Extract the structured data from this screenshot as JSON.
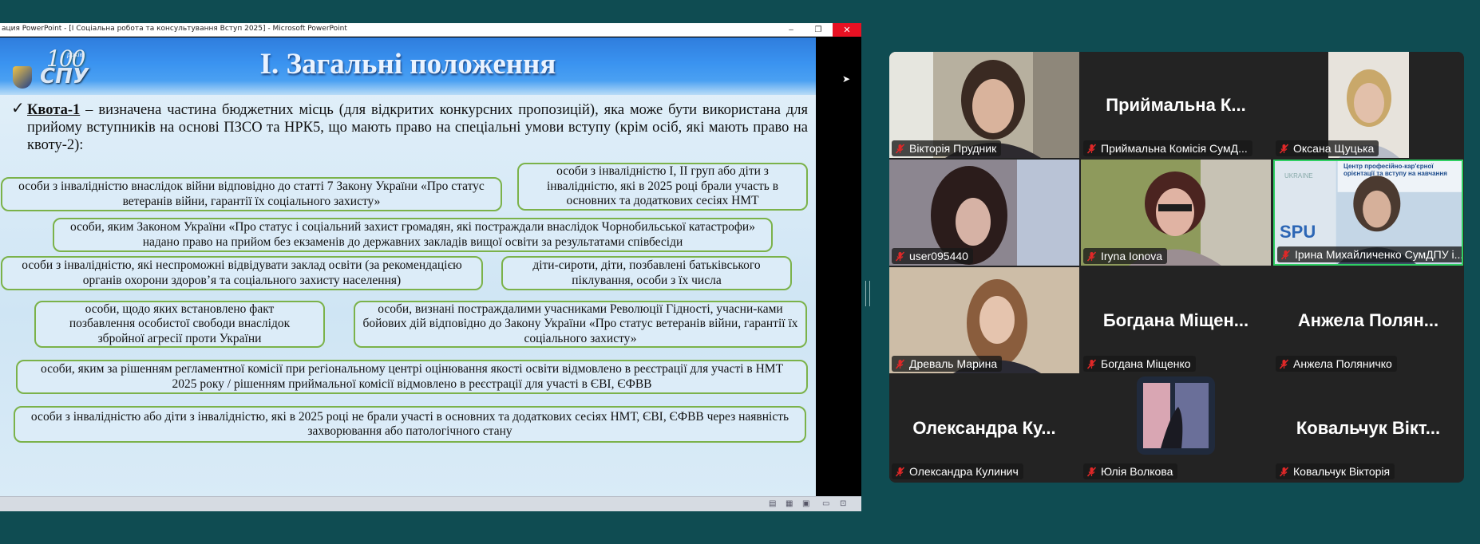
{
  "window": {
    "title": "ация PowerPoint - [I Соціальна робота та консультування Вступ 2025] - Microsoft PowerPoint",
    "controls": {
      "minimize": "–",
      "maximize": "❐",
      "close": "✕"
    }
  },
  "slide": {
    "logo": {
      "years": "100",
      "years_suffix": "років",
      "acronym": "СПУ"
    },
    "title": "І. Загальні положення",
    "intro": {
      "term": "Квота-1",
      "text": " – визначена частина бюджетних місць (для відкритих конкурсних пропозицій), яка може бути використана для прийому вступників на основі ПЗСО та НРК5, що мають право на спеціальні умови вступу (крім осіб, які мають право на квоту-2):"
    },
    "boxes": [
      "особи з інвалідністю внаслідок війни відповідно до статті 7 Закону України «Про статус ветеранів війни, гарантії їх соціального захисту»",
      "особи з інвалідністю І, ІІ груп або діти з інвалідністю, які в 2025 році брали участь в основних та додаткових сесіях НМТ",
      "особи, яким Законом України «Про статус і соціальний захист громадян, які постраждали внаслідок Чорнобильської катастрофи» надано право на прийом без екзаменів до державних закладів вищої освіти за результатами співбесіди",
      "особи з інвалідністю, які неспроможні відвідувати заклад освіти (за рекомендацією органів охорони здоров’я та соціального захисту населення)",
      "діти-сироти, діти, позбавлені батьківського піклування, особи з їх числа",
      "особи, щодо яких встановлено факт позбавлення особистої свободи внаслідок збройної агресії проти України",
      "особи, визнані постраждалими учасниками Революції Гідності, учасни-ками бойових дій відповідно до Закону України «Про статус ветеранів війни, гарантії їх соціального захисту»",
      "особи, яким за рішенням регламентної комісії при регіональному центрі оцінювання якості освіти відмовлено в реєстрації для участі в НМТ 2025 року / рішенням приймальної комісії відмовлено в реєстрації для участі в ЄВІ, ЄФВВ",
      "особи з інвалідністю або діти з інвалідністю, які в 2025 році не брали участі в основних та додаткових сесіях НМТ, ЄВІ, ЄФВВ через наявність захворювання або патологічного стану"
    ]
  },
  "participants": [
    {
      "name": "Вікторія Прудник",
      "big": "",
      "video": true
    },
    {
      "name": "Приймальна Комісія СумД...",
      "big": "Приймальна К...",
      "video": false
    },
    {
      "name": "Оксана Щуцька",
      "big": "",
      "video": true
    },
    {
      "name": "user095440",
      "big": "",
      "video": true
    },
    {
      "name": "Iryna Ionova",
      "big": "",
      "video": true
    },
    {
      "name": "Ірина Михайличенко СумДПУ і...",
      "big": "",
      "video": true,
      "active": true,
      "overlay": "Центр професійно-кар'єрної орієнтації та вступу на навчання",
      "brand": "SPU",
      "ukraine": "UKRAINE"
    },
    {
      "name": "Древаль Марина",
      "big": "",
      "video": true
    },
    {
      "name": "Богдана Міщенко",
      "big": "Богдана Міщен...",
      "video": false
    },
    {
      "name": "Анжела Поляничко",
      "big": "Анжела Полян...",
      "video": false
    },
    {
      "name": "Олександра Кулинич",
      "big": "Олександра Ку...",
      "video": false
    },
    {
      "name": "Юлія Волкова",
      "big": "",
      "video": true
    },
    {
      "name": "Ковальчук Вікторія",
      "big": "Ковальчук Вікт...",
      "video": false
    }
  ],
  "colors": {
    "background": "#0f4c52",
    "gallery": "#232323",
    "active_border": "#2fcf63",
    "mute_icon": "#e02828",
    "box_border": "#7bb24a"
  }
}
